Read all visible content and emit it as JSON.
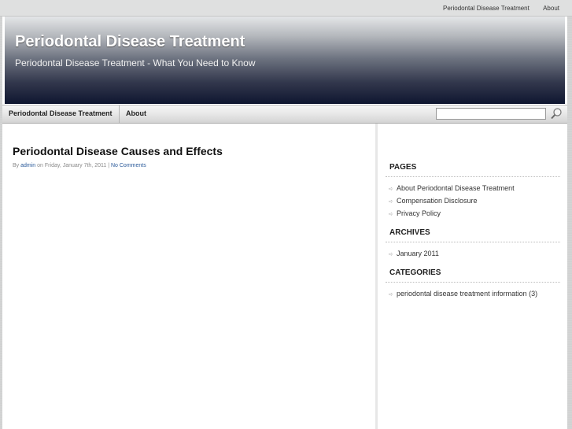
{
  "topbar": {
    "links": [
      "Periodontal Disease Treatment",
      "About"
    ]
  },
  "header": {
    "title": "Periodontal Disease Treatment",
    "tagline": "Periodontal Disease Treatment - What You Need to Know"
  },
  "nav": {
    "items": [
      "Periodontal Disease Treatment",
      "About"
    ]
  },
  "search": {
    "value": "",
    "icon": "search-icon"
  },
  "post": {
    "title": "Periodontal Disease Causes and Effects",
    "meta": {
      "by": "By",
      "author": "admin",
      "on": "on",
      "date": "Friday, January 7th, 2011",
      "separator": "|",
      "comments": "No Comments"
    }
  },
  "sidebar": {
    "pages": {
      "title": "PAGES",
      "items": [
        "About Periodontal Disease Treatment",
        "Compensation Disclosure",
        "Privacy Policy"
      ]
    },
    "archives": {
      "title": "ARCHIVES",
      "items": [
        "January 2011"
      ]
    },
    "categories": {
      "title": "CATEGORIES",
      "items": [
        "periodontal disease treatment information (3)"
      ]
    }
  },
  "colors": {
    "link": "#2a5a9a",
    "header_dark": "#0f1630",
    "header_light": "#e4e6e8"
  }
}
